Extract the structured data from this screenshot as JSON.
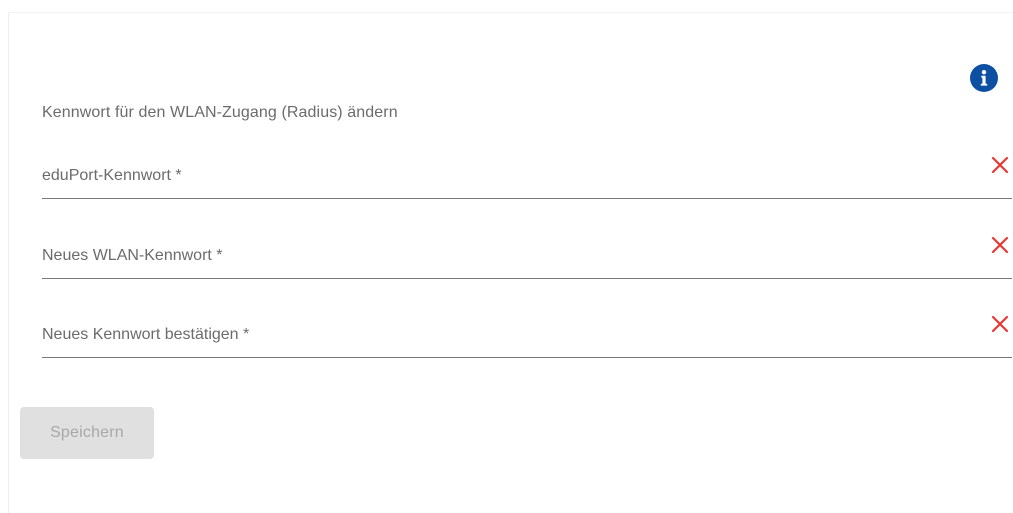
{
  "form": {
    "heading": "Kennwort für den WLAN-Zugang (Radius) ändern",
    "info_icon": "info-circle-icon",
    "fields": [
      {
        "placeholder": "eduPort-Kennwort *",
        "value": "",
        "clear_icon": "close-x-icon"
      },
      {
        "placeholder": "Neues WLAN-Kennwort *",
        "value": "",
        "clear_icon": "close-x-icon"
      },
      {
        "placeholder": "Neues Kennwort bestätigen *",
        "value": "",
        "clear_icon": "close-x-icon"
      }
    ],
    "save_label": "Speichern",
    "save_disabled": true
  },
  "colors": {
    "info_icon": "#0d4fa3",
    "clear_icon": "#e53935",
    "text_muted": "#6b6b6b",
    "underline": "#7a7a7a",
    "button_disabled_bg": "#e0e0e0",
    "button_disabled_text": "#a8a8a8"
  }
}
